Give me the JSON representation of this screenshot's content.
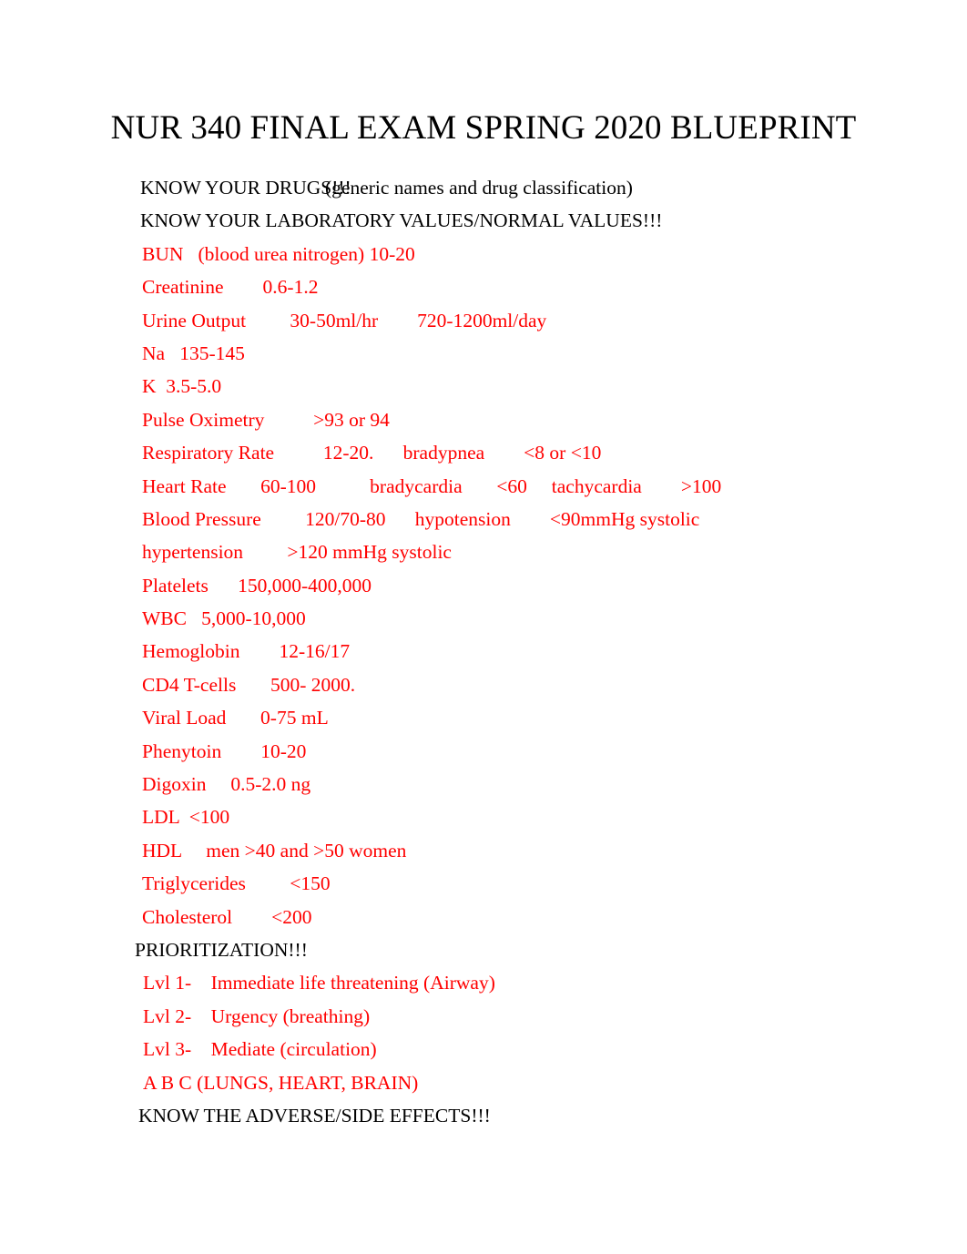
{
  "document": {
    "title": "NUR 340 FINAL EXAM SPRING 2020 BLUEPRINT",
    "colors": {
      "text": "#000000",
      "highlight_red": "#ff0000",
      "page_background": "#ffffff"
    }
  },
  "headings": {
    "drugs_heading": "KNOW YOUR DRUGS!!!",
    "drugs_parenthetical": "(generic names and drug classification)",
    "lab_values_heading": "KNOW YOUR LABORATORY VALUES/NORMAL VALUES!!!",
    "prioritization_heading": "PRIORITIZATION!!!",
    "adverse_effects_heading": "KNOW THE ADVERSE/SIDE EFFECTS!!!"
  },
  "lab_values": [
    {
      "line": "BUN   (blood urea nitrogen) 10-20"
    },
    {
      "line": "Creatinine        0.6-1.2"
    },
    {
      "line": "Urine Output         30-50ml/hr        720-1200ml/day"
    },
    {
      "line": "Na   135-145"
    },
    {
      "line": "K  3.5-5.0"
    },
    {
      "line": "Pulse Oximetry          >93 or 94"
    },
    {
      "line": "Respiratory Rate          12-20.      bradypnea        <8 or <10"
    },
    {
      "line": "Heart Rate       60-100           bradycardia       <60     tachycardia        >100"
    },
    {
      "line": "Blood Pressure         120/70-80      hypotension        <90mmHg systolic"
    },
    {
      "line": "hypertension         >120 mmHg systolic"
    },
    {
      "line": "Platelets      150,000-400,000"
    },
    {
      "line": "WBC   5,000-10,000"
    },
    {
      "line": "Hemoglobin        12-16/17"
    },
    {
      "line": "CD4 T-cells       500- 2000."
    },
    {
      "line": "Viral Load       0-75 mL"
    },
    {
      "line": "Phenytoin        10-20"
    },
    {
      "line": "Digoxin     0.5-2.0 ng"
    },
    {
      "line": "LDL  <100"
    },
    {
      "line": "HDL     men >40 and >50 women"
    },
    {
      "line": "Triglycerides         <150"
    },
    {
      "line": "Cholesterol        <200"
    }
  ],
  "prioritization": {
    "levels": [
      {
        "line": "Lvl 1-    Immediate life threatening (Airway)"
      },
      {
        "line": "Lvl 2-    Urgency (breathing)"
      },
      {
        "line": "Lvl 3-    Mediate (circulation)"
      }
    ],
    "abc_note": "A B C (LUNGS, HEART, BRAIN)"
  }
}
